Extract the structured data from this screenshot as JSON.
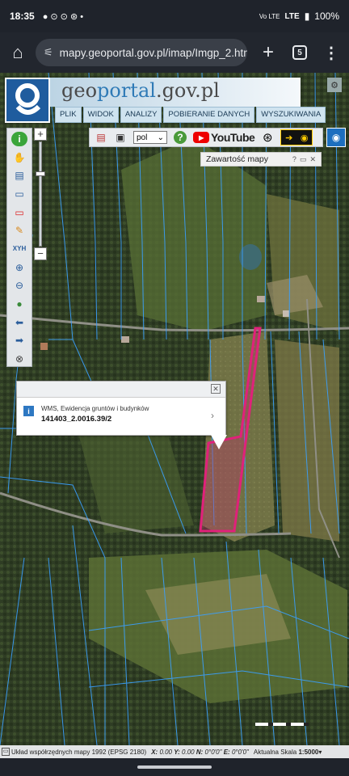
{
  "status": {
    "time": "18:35",
    "notif": "● ⊙ ⊙ ⊛ •",
    "net": "Vo LTE",
    "lte": "LTE",
    "battery": "100%"
  },
  "browser": {
    "url": "mapy.geoportal.gov.pl/imap/Imgp_2.html?ide",
    "tab_count": "5"
  },
  "header": {
    "title_prefix": "geo",
    "title_highlight": "portal",
    "title_suffix": ".gov.pl",
    "menu": [
      "PLIK",
      "WIDOK",
      "ANALIZY",
      "POBIERANIE DANYCH",
      "WYSZUKIWANIA"
    ]
  },
  "toolbar": {
    "language": "pol",
    "youtube_label": "YouTube"
  },
  "contents_panel": {
    "title": "Zawartość mapy",
    "help": "?",
    "minimize": "▭",
    "close": "✕"
  },
  "left_tools": [
    "info-icon",
    "pan-icon",
    "layers-icon",
    "select-rectangle-icon",
    "clear-selection-icon",
    "draw-icon",
    "coordinates-icon",
    "zoom-in-tool-icon",
    "zoom-out-tool-icon",
    "globe-icon",
    "back-icon",
    "forward-icon",
    "measure-icon"
  ],
  "left_tools_xyh": "XYH",
  "popup": {
    "layer": "WMS, Ewidencja gruntów i budynków",
    "value": "141403_2.0016.39/2",
    "close": "✕"
  },
  "footer": {
    "label": "Układ współrzędnych mapy 1992 (EPSG 2180)",
    "x_label": "X:",
    "x_value": "0.00",
    "y_label": "Y:",
    "y_value": "0.00",
    "n_label": "N:",
    "n_value": "0°0'0\"",
    "e_label": "E:",
    "e_value": "0°0'0\"",
    "scale_label": "Aktualna Skala",
    "scale_value": "1:5000"
  },
  "colors": {
    "parcel_outline": "#e0217a",
    "parcel_lines": "#3aa0ff",
    "logo_bg": "#1f5c9e"
  }
}
